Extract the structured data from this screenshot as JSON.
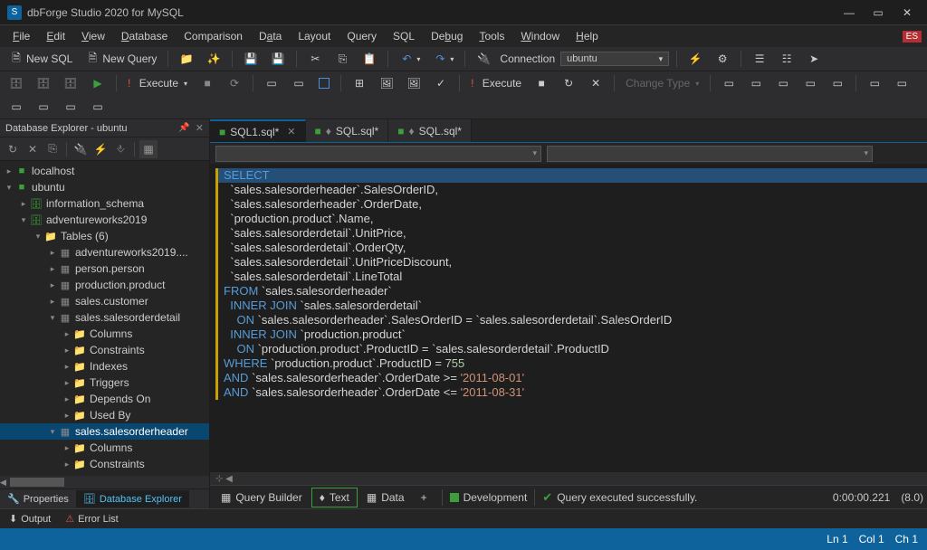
{
  "app": {
    "title": "dbForge Studio 2020 for MySQL",
    "lang_badge": "ES"
  },
  "menu": {
    "file": "File",
    "edit": "Edit",
    "view": "View",
    "database": "Database",
    "comparison": "Comparison",
    "data": "Data",
    "layout": "Layout",
    "query": "Query",
    "sql": "SQL",
    "debug": "Debug",
    "tools": "Tools",
    "window": "Window",
    "help": "Help"
  },
  "toolbar1": {
    "new_sql": "New SQL",
    "new_query": "New Query",
    "connection_label": "Connection",
    "connection_value": "ubuntu"
  },
  "toolbar2": {
    "execute": "Execute",
    "execute2": "Execute",
    "change_type": "Change Type"
  },
  "explorer": {
    "title": "Database Explorer - ubuntu",
    "tree": {
      "localhost": "localhost",
      "ubuntu": "ubuntu",
      "info_schema": "information_schema",
      "adventureworks": "adventureworks2019",
      "tables": "Tables (6)",
      "tbl_adv": "adventureworks2019....",
      "tbl_person": "person.person",
      "tbl_product": "production.product",
      "tbl_customer": "sales.customer",
      "tbl_orderdetail": "sales.salesorderdetail",
      "tbl_orderheader": "sales.salesorderheader",
      "columns": "Columns",
      "constraints": "Constraints",
      "indexes": "Indexes",
      "triggers": "Triggers",
      "depends": "Depends On",
      "usedby": "Used By"
    },
    "tabs": {
      "properties": "Properties",
      "db_explorer": "Database Explorer"
    }
  },
  "editor": {
    "tabs": {
      "t1": "SQL1.sql*",
      "t2": "SQL.sql*",
      "t3": "SQL.sql*"
    },
    "code_lines": [
      {
        "indent": 0,
        "tokens": [
          {
            "t": "kw",
            "v": "SELECT"
          }
        ]
      },
      {
        "indent": 1,
        "tokens": [
          {
            "t": "ident",
            "v": "`sales.salesorderheader`.SalesOrderID,"
          }
        ]
      },
      {
        "indent": 1,
        "tokens": [
          {
            "t": "ident",
            "v": "`sales.salesorderheader`.OrderDate,"
          }
        ]
      },
      {
        "indent": 1,
        "tokens": [
          {
            "t": "ident",
            "v": "`production.product`.Name,"
          }
        ]
      },
      {
        "indent": 1,
        "tokens": [
          {
            "t": "ident",
            "v": "`sales.salesorderdetail`.UnitPrice,"
          }
        ]
      },
      {
        "indent": 1,
        "tokens": [
          {
            "t": "ident",
            "v": "`sales.salesorderdetail`.OrderQty,"
          }
        ]
      },
      {
        "indent": 1,
        "tokens": [
          {
            "t": "ident",
            "v": "`sales.salesorderdetail`.UnitPriceDiscount,"
          }
        ]
      },
      {
        "indent": 1,
        "tokens": [
          {
            "t": "ident",
            "v": "`sales.salesorderdetail`.LineTotal"
          }
        ]
      },
      {
        "indent": 0,
        "tokens": [
          {
            "t": "kw",
            "v": "FROM"
          },
          {
            "t": "ident",
            "v": " `sales.salesorderheader`"
          }
        ]
      },
      {
        "indent": 1,
        "tokens": [
          {
            "t": "kw",
            "v": "INNER JOIN"
          },
          {
            "t": "ident",
            "v": " `sales.salesorderdetail`"
          }
        ]
      },
      {
        "indent": 2,
        "tokens": [
          {
            "t": "kw",
            "v": "ON"
          },
          {
            "t": "ident",
            "v": " `sales.salesorderheader`.SalesOrderID = `sales.salesorderdetail`.SalesOrderID"
          }
        ]
      },
      {
        "indent": 1,
        "tokens": [
          {
            "t": "kw",
            "v": "INNER JOIN"
          },
          {
            "t": "ident",
            "v": " `production.product`"
          }
        ]
      },
      {
        "indent": 2,
        "tokens": [
          {
            "t": "kw",
            "v": "ON"
          },
          {
            "t": "ident",
            "v": " `production.product`.ProductID = `sales.salesorderdetail`.ProductID"
          }
        ]
      },
      {
        "indent": 0,
        "tokens": [
          {
            "t": "kw",
            "v": "WHERE"
          },
          {
            "t": "ident",
            "v": " `production.product`.ProductID = "
          },
          {
            "t": "num",
            "v": "755"
          }
        ]
      },
      {
        "indent": 0,
        "tokens": [
          {
            "t": "kw",
            "v": "AND"
          },
          {
            "t": "ident",
            "v": " `sales.salesorderheader`.OrderDate >= "
          },
          {
            "t": "str",
            "v": "'2011-08-01'"
          }
        ]
      },
      {
        "indent": 0,
        "tokens": [
          {
            "t": "kw",
            "v": "AND"
          },
          {
            "t": "ident",
            "v": " `sales.salesorderheader`.OrderDate <= "
          },
          {
            "t": "str",
            "v": "'2011-08-31'"
          }
        ]
      }
    ],
    "footer": {
      "query_builder": "Query Builder",
      "text": "Text",
      "data": "Data",
      "development": "Development",
      "success": "Query executed successfully.",
      "time": "0:00:00.221",
      "pool": "(8.0)"
    }
  },
  "output": {
    "output": "Output",
    "error_list": "Error List"
  },
  "status": {
    "ln": "Ln 1",
    "col": "Col 1",
    "ch": "Ch 1"
  }
}
